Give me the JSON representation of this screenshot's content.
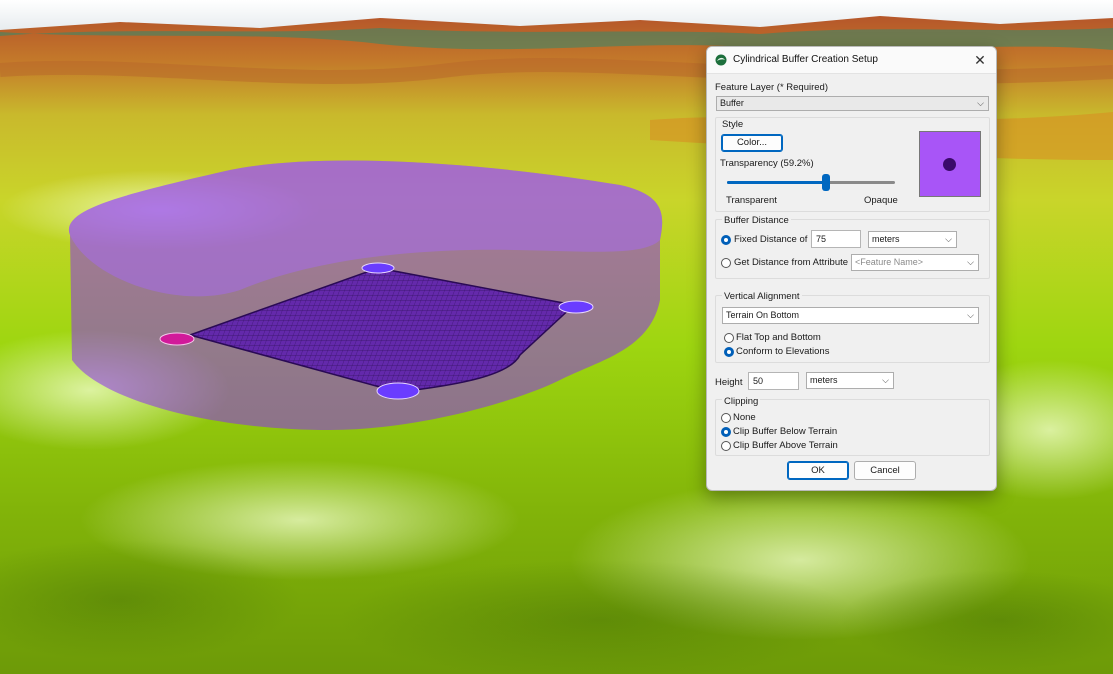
{
  "dialog": {
    "title": "Cylindrical Buffer Creation Setup",
    "close_glyph": "✕",
    "feature_layer_label": "Feature Layer (* Required)",
    "feature_layer_value": "Buffer",
    "style_label": "Style",
    "color_button": "Color...",
    "transparency_label": "Transparency (59.2%)",
    "transparency_value": 0.592,
    "transparent_label": "Transparent",
    "opaque_label": "Opaque",
    "preview_color": "#a855f7",
    "buffer_distance_label": "Buffer Distance",
    "fixed_distance_label": "Fixed Distance of",
    "fixed_distance_value": "75",
    "fixed_distance_units": "meters",
    "attr_distance_label": "Get Distance from Attribute",
    "attr_distance_placeholder": "<Feature Name>",
    "vertical_alignment_label": "Vertical Alignment",
    "vertical_alignment_value": "Terrain On Bottom",
    "flat_label": "Flat Top and Bottom",
    "conform_label": "Conform to Elevations",
    "height_label": "Height",
    "height_value": "50",
    "height_units": "meters",
    "clipping_label": "Clipping",
    "clip_none": "None",
    "clip_below": "Clip Buffer Below Terrain",
    "clip_above": "Clip Buffer Above Terrain",
    "ok_button": "OK",
    "cancel_button": "Cancel",
    "dropdown_glyph": "⌵",
    "accent": "#0067c0"
  }
}
